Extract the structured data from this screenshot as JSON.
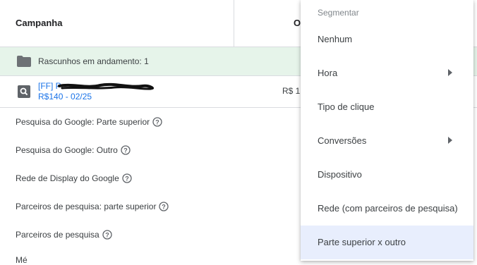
{
  "table": {
    "header": {
      "campaign_label": "Campanha",
      "second_col_label": "Or"
    },
    "drafts_label": "Rascunhos em andamento: 1",
    "campaign": {
      "name": "[FF] P",
      "budget": "R$140 - 02/25",
      "cost": "R$ 1"
    },
    "segments": [
      "Pesquisa do Google: Parte superior",
      "Pesquisa do Google: Outro",
      "Rede de Display do Google",
      "Parceiros de pesquisa: parte superior",
      "Parceiros de pesquisa",
      "Mé"
    ]
  },
  "menu": {
    "title": "Segmentar",
    "items": [
      {
        "label": "Nenhum",
        "submenu": false,
        "selected": false
      },
      {
        "label": "Hora",
        "submenu": true,
        "selected": false
      },
      {
        "label": "Tipo de clique",
        "submenu": false,
        "selected": false
      },
      {
        "label": "Conversões",
        "submenu": true,
        "selected": false
      },
      {
        "label": "Dispositivo",
        "submenu": false,
        "selected": false
      },
      {
        "label": "Rede (com parceiros de pesquisa)",
        "submenu": false,
        "selected": false
      },
      {
        "label": "Parte superior x outro",
        "submenu": false,
        "selected": true
      }
    ]
  },
  "icons": {
    "drafts": "folder-icon",
    "campaign_type": "search-icon",
    "help": "help-circle-icon",
    "submenu": "chevron-right-icon"
  },
  "colors": {
    "drafts_bg": "#e6f4ea",
    "link": "#1a73e8",
    "selected_bg": "#e8eefd"
  }
}
